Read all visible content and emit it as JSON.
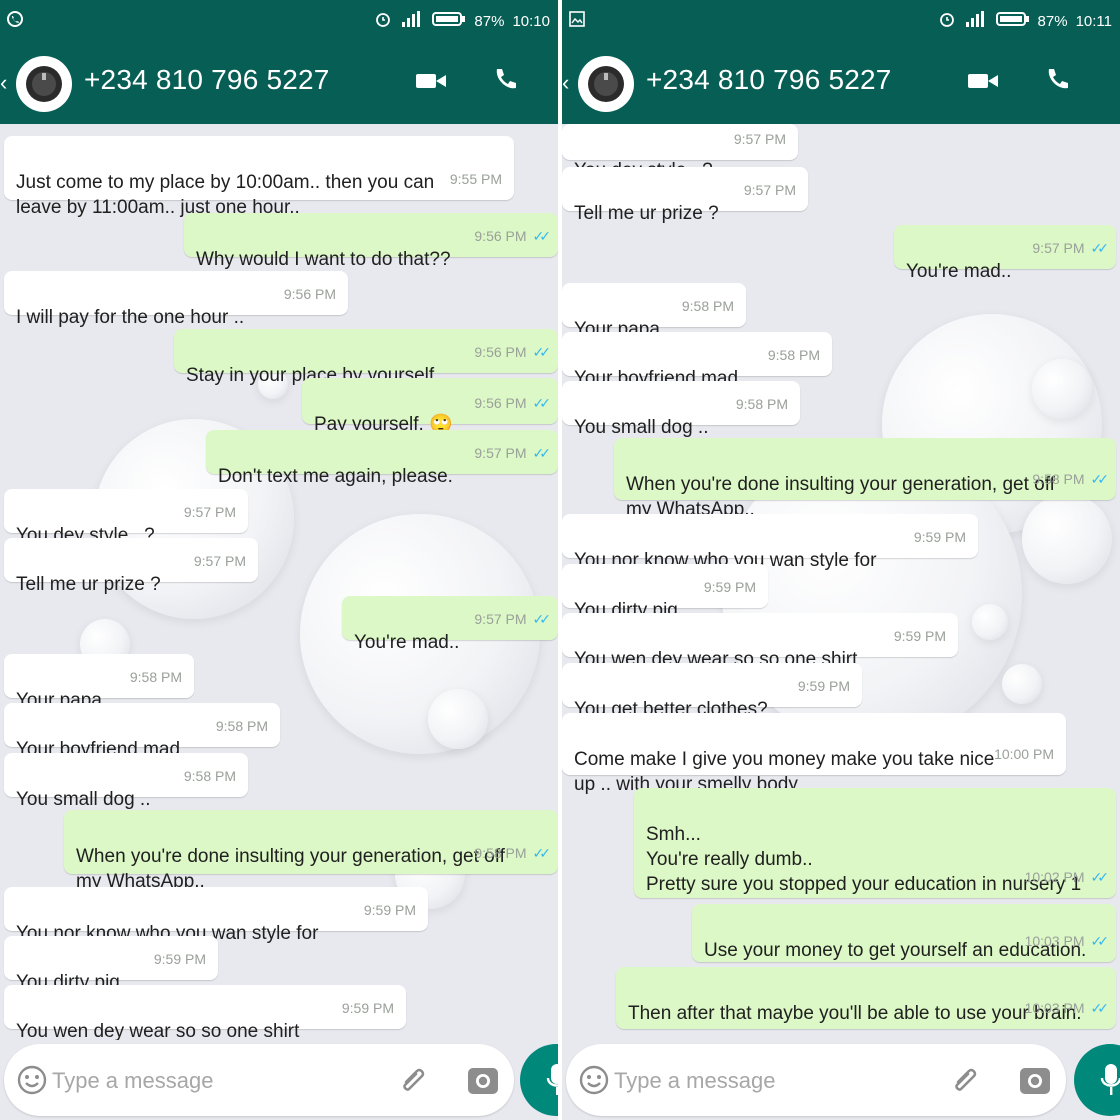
{
  "status": {
    "left": {
      "battery": "87%",
      "time": "10:10"
    },
    "right": {
      "battery": "87%",
      "time": "10:11"
    }
  },
  "header": {
    "contact": "+234 810 796 5227"
  },
  "input": {
    "placeholder": "Type a message"
  },
  "left_messages": [
    {
      "type": "in",
      "text": "Just come to my place by 10:00am.. then you can\nleave by 11:00am.. just one hour..",
      "time": "9:55 PM"
    },
    {
      "type": "out",
      "text": "Why would I want to do that??",
      "time": "9:56 PM"
    },
    {
      "type": "in",
      "text": "I will pay for the one hour ..",
      "time": "9:56 PM"
    },
    {
      "type": "out",
      "text": "Stay in your place by yourself...",
      "time": "9:56 PM"
    },
    {
      "type": "out",
      "text": "Pay yourself, 🙄",
      "time": "9:56 PM"
    },
    {
      "type": "out",
      "text": "Don't text me again, please.",
      "time": "9:57 PM"
    },
    {
      "type": "in",
      "text": "You dey style.. ?",
      "time": "9:57 PM"
    },
    {
      "type": "in",
      "text": "Tell me ur prize ?",
      "time": "9:57 PM"
    },
    {
      "type": "out",
      "text": "You're mad..",
      "time": "9:57 PM"
    },
    {
      "type": "in",
      "text": "Your papa",
      "time": "9:58 PM"
    },
    {
      "type": "in",
      "text": "Your boyfriend mad",
      "time": "9:58 PM"
    },
    {
      "type": "in",
      "text": "You small dog ..",
      "time": "9:58 PM"
    },
    {
      "type": "out",
      "text": "When you're done insulting your generation, get off\nmy WhatsApp..",
      "time": "9:58 PM"
    },
    {
      "type": "in",
      "text": "You nor know who you wan style for",
      "time": "9:59 PM"
    },
    {
      "type": "in",
      "text": "You dirty pig",
      "time": "9:59 PM"
    },
    {
      "type": "in",
      "text": "You wen dey wear so so one shirt",
      "time": "9:59 PM"
    }
  ],
  "right_messages": [
    {
      "type": "in",
      "text": "You dey style.. ?",
      "time": "9:57 PM"
    },
    {
      "type": "in",
      "text": "Tell me ur prize ?",
      "time": "9:57 PM"
    },
    {
      "type": "out",
      "text": "You're mad..",
      "time": "9:57 PM"
    },
    {
      "type": "in",
      "text": "Your papa",
      "time": "9:58 PM"
    },
    {
      "type": "in",
      "text": "Your boyfriend mad",
      "time": "9:58 PM"
    },
    {
      "type": "in",
      "text": "You small dog ..",
      "time": "9:58 PM"
    },
    {
      "type": "out",
      "text": "When you're done insulting your generation, get off\nmy WhatsApp..",
      "time": "9:58 PM"
    },
    {
      "type": "in",
      "text": "You nor know who you wan style for",
      "time": "9:59 PM"
    },
    {
      "type": "in",
      "text": "You dirty pig",
      "time": "9:59 PM"
    },
    {
      "type": "in",
      "text": "You wen dey wear so so one shirt",
      "time": "9:59 PM"
    },
    {
      "type": "in",
      "text": "You get better clothes?",
      "time": "9:59 PM"
    },
    {
      "type": "in",
      "text": "Come make I give you money make you take nice\nup .. with your smelly body",
      "time": "10:00 PM"
    },
    {
      "type": "out",
      "text": "Smh...\nYou're really dumb..\nPretty sure you stopped your education in nursery 1",
      "time": "10:02 PM"
    },
    {
      "type": "out",
      "text": "Use your money to get yourself an education.",
      "time": "10:03 PM"
    },
    {
      "type": "out",
      "text": "Then after that maybe you'll be able to use your brain.",
      "time": "10:03 PM"
    }
  ],
  "colors": {
    "header": "#075e54",
    "incoming": "#ffffff",
    "outgoing": "#dcf8c6",
    "tick": "#34b7f1",
    "mic": "#00897b"
  },
  "icons": {
    "status_left": "whatsapp-icon",
    "status_right": "image-icon",
    "video": "video-call-icon",
    "call": "phone-icon",
    "emoji": "emoji-icon",
    "attach": "attach-icon",
    "camera": "camera-icon",
    "mic": "mic-icon"
  }
}
